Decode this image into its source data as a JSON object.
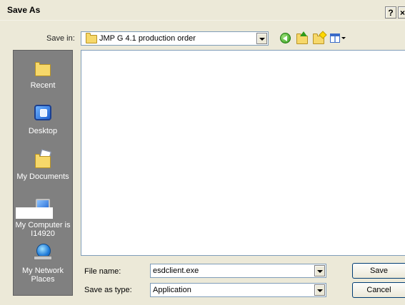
{
  "window": {
    "title": "Save As",
    "help_label": "?",
    "close_label": "×"
  },
  "save_in": {
    "label": "Save in:",
    "value": "JMP G 4.1 production order"
  },
  "toolbar": {
    "icons": [
      "back-icon",
      "up-folder-icon",
      "new-folder-icon",
      "views-menu-icon"
    ]
  },
  "places": [
    {
      "label": "Recent",
      "icon": "recent-folder-icon"
    },
    {
      "label": "Desktop",
      "icon": "desktop-icon"
    },
    {
      "label": "My Documents",
      "icon": "my-documents-icon"
    },
    {
      "label": "My Computer is I14920",
      "icon": "my-computer-icon"
    },
    {
      "label": "My Network Places",
      "icon": "my-network-icon"
    }
  ],
  "file_name": {
    "label": "File name:",
    "value": "esdclient.exe"
  },
  "save_as_type": {
    "label": "Save as type:",
    "value": "Application"
  },
  "buttons": {
    "save": "Save",
    "cancel": "Cancel"
  },
  "colors": {
    "dialog_bg": "#ece9d8",
    "places_bg": "#808080",
    "field_border": "#7f9db9"
  }
}
